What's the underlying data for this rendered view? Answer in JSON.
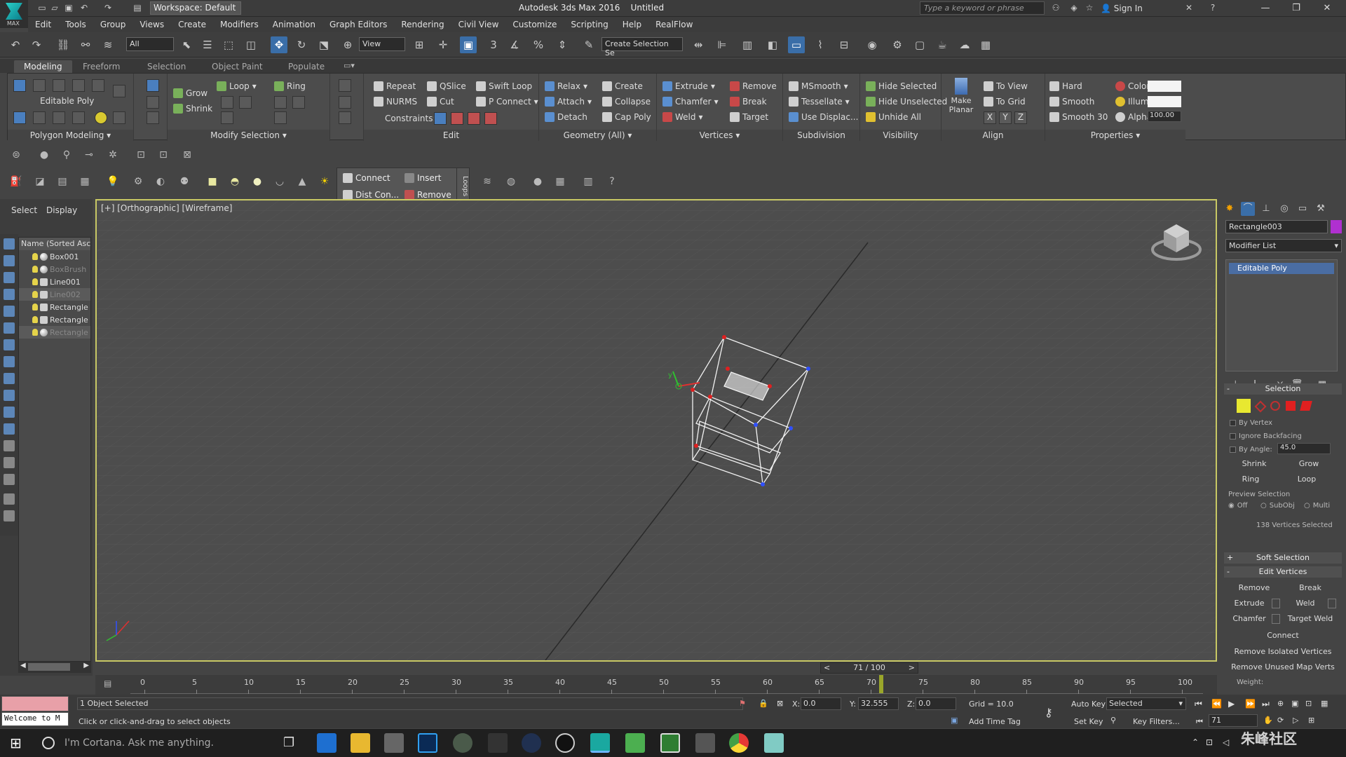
{
  "app": {
    "title": "Autodesk 3ds Max 2016",
    "file": "Untitled",
    "workspace": "Workspace: Default",
    "search_placeholder": "Type a keyword or phrase",
    "sign_in": "Sign In",
    "logo_label": "MAX"
  },
  "menus": [
    "Edit",
    "Tools",
    "Group",
    "Views",
    "Create",
    "Modifiers",
    "Animation",
    "Graph Editors",
    "Rendering",
    "Civil View",
    "Customize",
    "Scripting",
    "Help",
    "RealFlow"
  ],
  "toolbar": {
    "selection_filter": "All",
    "ref_coord": "View",
    "named_selection": "Create Selection Se",
    "snap_label": "3"
  },
  "ribbon": {
    "tabs": [
      "Modeling",
      "Freeform",
      "Selection",
      "Object Paint",
      "Populate"
    ],
    "sections": {
      "polygon_modeling": {
        "footer": "Polygon Modeling",
        "label": "Editable Poly"
      },
      "modify_selection": {
        "footer": "Modify Selection",
        "grow": "Grow",
        "shrink": "Shrink",
        "loop": "Loop",
        "ring": "Ring"
      },
      "edit": {
        "footer": "Edit",
        "repeat": "Repeat",
        "qslice": "QSlice",
        "swift_loop": "Swift Loop",
        "nurms": "NURMS",
        "cut": "Cut",
        "p_connect": "P Connect",
        "constraints": "Constraints:"
      },
      "geometry": {
        "footer": "Geometry (All)",
        "relax": "Relax",
        "create": "Create",
        "attach": "Attach",
        "collapse": "Collapse",
        "detach": "Detach",
        "cap_poly": "Cap Poly"
      },
      "vertices": {
        "footer": "Vertices",
        "extrude": "Extrude",
        "remove": "Remove",
        "chamfer": "Chamfer",
        "break": "Break",
        "weld": "Weld",
        "target": "Target"
      },
      "subdivision": {
        "footer": "Subdivision",
        "msmooth": "MSmooth",
        "tessellate": "Tessellate",
        "use_displac": "Use Displac..."
      },
      "visibility": {
        "footer": "Visibility",
        "hide_selected": "Hide Selected",
        "hide_unselected": "Hide Unselected",
        "unhide_all": "Unhide All"
      },
      "align": {
        "footer": "Align",
        "make_planar": "Make Planar",
        "to_view": "To View",
        "to_grid": "To Grid",
        "x": "X",
        "y": "Y",
        "z": "Z"
      },
      "properties": {
        "footer": "Properties",
        "hard": "Hard",
        "smooth": "Smooth",
        "smooth30": "Smooth 30",
        "color": "Color:",
        "illum": "Illum:",
        "alpha": "Alpha:",
        "alpha_value": "100.00"
      }
    }
  },
  "quadmenu": {
    "connect": "Connect",
    "insert": "Insert",
    "dist_con": "Dist Con...",
    "remove": "Remove",
    "side": "Loops"
  },
  "scene_explorer": {
    "tabs": [
      "Select",
      "Display"
    ],
    "column": "Name (Sorted Ascen",
    "items": [
      {
        "name": "Box001",
        "dim": false
      },
      {
        "name": "BoxBrush",
        "dim": true
      },
      {
        "name": "Line001",
        "dim": false
      },
      {
        "name": "Line002",
        "dim": true
      },
      {
        "name": "Rectangle",
        "dim": false
      },
      {
        "name": "Rectangle",
        "dim": false
      },
      {
        "name": "Rectangle",
        "dim": true
      }
    ]
  },
  "viewport": {
    "label": "[+] [Orthographic] [Wireframe]",
    "frame": "71 / 100"
  },
  "command_panel": {
    "object_name": "Rectangle003",
    "object_color": "#b030d0",
    "modifier_list": "Modifier List",
    "stack_item": "Editable Poly",
    "selection": {
      "title": "Selection",
      "by_vertex": "By Vertex",
      "ignore_backfacing": "Ignore Backfacing",
      "by_angle": "By Angle:",
      "angle_value": "45.0",
      "shrink": "Shrink",
      "grow": "Grow",
      "ring": "Ring",
      "loop": "Loop",
      "preview": "Preview Selection",
      "off": "Off",
      "subobj": "SubObj",
      "multi": "Multi",
      "count": "138 Vertices Selected"
    },
    "soft_selection": "Soft Selection",
    "edit_vertices": {
      "title": "Edit Vertices",
      "remove": "Remove",
      "break": "Break",
      "extrude": "Extrude",
      "weld": "Weld",
      "chamfer": "Chamfer",
      "target_weld": "Target Weld",
      "connect": "Connect",
      "remove_isolated": "Remove Isolated Vertices",
      "remove_unused": "Remove Unused Map Verts",
      "weight": "Weight:"
    }
  },
  "timeline": {
    "ticks": [
      "0",
      "5",
      "10",
      "15",
      "20",
      "25",
      "30",
      "35",
      "40",
      "45",
      "50",
      "55",
      "60",
      "65",
      "70",
      "75",
      "80",
      "85",
      "90",
      "95",
      "100"
    ],
    "current": 71
  },
  "status": {
    "welcome": "Welcome to M",
    "objects": "1 Object Selected",
    "hint": "Click or click-and-drag to select objects",
    "x_label": "X:",
    "x_value": "0.0",
    "y_label": "Y:",
    "y_value": "32.555",
    "z_label": "Z:",
    "z_value": "0.0",
    "grid": "Grid = 10.0",
    "add_time_tag": "Add Time Tag",
    "auto_key": "Auto Key",
    "set_key": "Set Key",
    "selected": "Selected",
    "key_filters": "Key Filters...",
    "frame_field": "71"
  },
  "taskbar": {
    "cortana": "I'm Cortana. Ask me anything."
  },
  "watermark": "朱峰社区"
}
